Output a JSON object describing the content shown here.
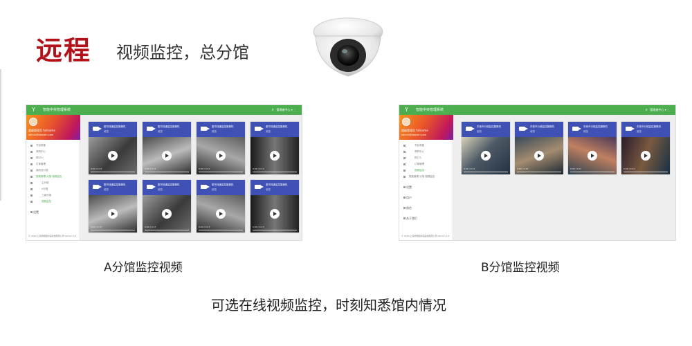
{
  "heading": {
    "main": "远程",
    "sub": "视频监控，总分馆"
  },
  "camera_image": {
    "icon": "dome-camera-icon"
  },
  "app": {
    "title": "智能中央管理系统",
    "search_icon": "⌕",
    "user": "管理者中心 ▾ ⋮",
    "accent": "#4cae4f",
    "card_color": "#3f51b5"
  },
  "panel_a": {
    "profile_name": "超级管理员 fullname",
    "profile_mail": "admin@domain.com",
    "nav": [
      {
        "label": "书目采集",
        "kind": "item"
      },
      {
        "label": "采购中心",
        "kind": "item"
      },
      {
        "label": "预订人",
        "kind": "item"
      },
      {
        "label": "订单管理",
        "kind": "item"
      },
      {
        "label": "我的总分馆",
        "kind": "item"
      },
      {
        "label": "智能管理·分馆·视频监控",
        "kind": "active"
      },
      {
        "label": "主分馆",
        "kind": "sub"
      },
      {
        "label": "A分馆",
        "kind": "sub"
      },
      {
        "label": "三级分馆",
        "kind": "sub"
      },
      {
        "label": "视频监控",
        "kind": "active-sub"
      },
      {
        "label": "设置",
        "kind": "sec"
      }
    ],
    "footer": "© 2019 上海智能图书馆系统有限公司 Version 1.0",
    "cards": [
      {
        "title": "图书流通监控摄像机",
        "sub": "阅览"
      },
      {
        "title": "图书流通监控摄像机",
        "sub": "阅览"
      },
      {
        "title": "图书流通监控摄像机",
        "sub": "阅览"
      },
      {
        "title": "图书流通监控摄像机",
        "sub": "阅览"
      },
      {
        "title": "图书流通监控摄像机",
        "sub": "阅览"
      },
      {
        "title": "图书流通监控摄像机",
        "sub": "阅览"
      },
      {
        "title": "图书流通监控摄像机",
        "sub": "阅览"
      },
      {
        "title": "图书流通监控摄像机",
        "sub": "阅览"
      }
    ],
    "video_time": "0:00 / 0:17"
  },
  "panel_b": {
    "profile_name": "超级管理员 fullname",
    "profile_mail": "admin@domain.com",
    "nav": [
      {
        "label": "书目采集",
        "kind": "sub"
      },
      {
        "label": "采购中心",
        "kind": "sub"
      },
      {
        "label": "预订人",
        "kind": "sub"
      },
      {
        "label": "订单管理",
        "kind": "sub"
      },
      {
        "label": "视频监控",
        "kind": "active-sub"
      },
      {
        "label": "智能管理·分馆·视频监控",
        "kind": "item"
      },
      {
        "label": "设置",
        "kind": "sec"
      },
      {
        "label": "用户",
        "kind": "sec"
      },
      {
        "label": "角色",
        "kind": "sec"
      },
      {
        "label": "关于我们",
        "kind": "sec"
      }
    ],
    "footer": "© 2019 上海智能图书馆系统有限公司 Version 1.0",
    "cards": [
      {
        "title": "东莞市分馆监控摄像机",
        "sub": "阅览"
      },
      {
        "title": "东莞市分馆监控摄像机",
        "sub": "阅览"
      },
      {
        "title": "东莞市分馆监控摄像机",
        "sub": "阅览"
      },
      {
        "title": "东莞市分馆监控摄像机",
        "sub": "阅览"
      }
    ],
    "video_time": "0:00 / 0:17"
  },
  "captions": {
    "a": "A分馆监控视频",
    "b": "B分馆监控视频"
  },
  "bottom_text": "可选在线视频监控，时刻知悉馆内情况"
}
